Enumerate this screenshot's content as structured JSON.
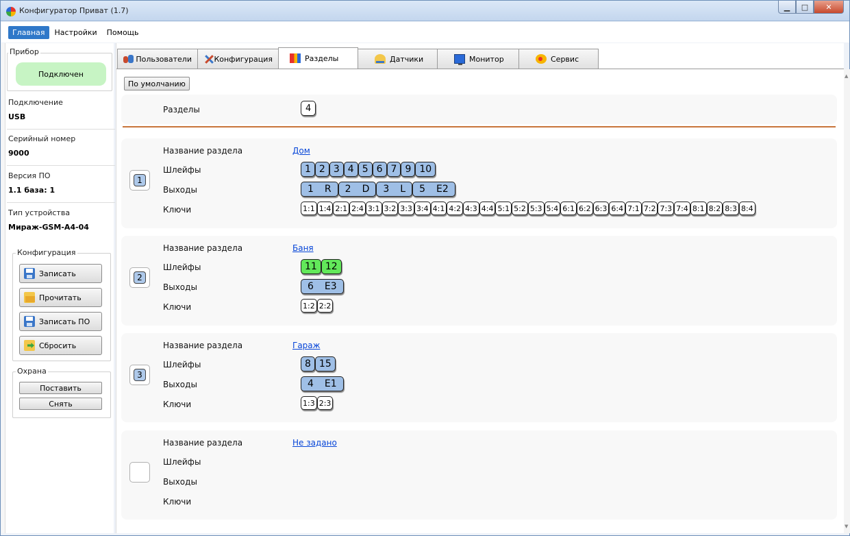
{
  "window": {
    "title": "Конфигуратор Приват (1.7)"
  },
  "menu": [
    "Главная",
    "Настройки",
    "Помощь"
  ],
  "left": {
    "device_group": "Прибор",
    "status": "Подключен",
    "info": [
      {
        "label": "Подключение",
        "value": "USB"
      },
      {
        "label": "Серийный номер",
        "value": "9000"
      },
      {
        "label": "Версия ПО",
        "value": "1.1 база: 1"
      },
      {
        "label": "Тип устройства",
        "value": "Мираж-GSM-A4-04"
      }
    ],
    "config_group": "Конфигурация",
    "config_buttons": [
      "Записать",
      "Прочитать",
      "Записать ПО",
      "Сбросить"
    ],
    "guard_group": "Охрана",
    "guard_buttons": [
      "Поставить",
      "Снять"
    ]
  },
  "tabs": [
    "Пользователи",
    "Конфигурация",
    "Разделы",
    "Датчики",
    "Монитор",
    "Сервис"
  ],
  "selected_tab": "Разделы",
  "default_button": "По умолчанию",
  "partitions_label": "Разделы",
  "partitions_count": "4",
  "field_labels": {
    "name": "Название раздела",
    "loops": "Шлейфы",
    "outputs": "Выходы",
    "keys": "Ключи"
  },
  "partitions": [
    {
      "num": "1",
      "name": "Дом",
      "loops": [
        "1",
        "2",
        "3",
        "4",
        "5",
        "6",
        "7",
        "9",
        "10"
      ],
      "outputs": [
        [
          "1",
          "R"
        ],
        [
          "2",
          "D"
        ],
        [
          "3",
          "L"
        ],
        [
          "5",
          "E2"
        ]
      ],
      "keys": [
        "1:1",
        "1:4",
        "2:1",
        "2:4",
        "3:1",
        "3:2",
        "3:3",
        "3:4",
        "4:1",
        "4:2",
        "4:3",
        "4:4",
        "5:1",
        "5:2",
        "5:3",
        "5:4",
        "6:1",
        "6:2",
        "6:3",
        "6:4",
        "7:1",
        "7:2",
        "7:3",
        "7:4",
        "8:1",
        "8:2",
        "8:3",
        "8:4"
      ]
    },
    {
      "num": "2",
      "name": "Баня",
      "loops": [
        "11",
        "12"
      ],
      "loops_color": "#62e85a",
      "outputs": [
        [
          "6",
          "E3"
        ]
      ],
      "keys": [
        "1:2",
        "2:2"
      ]
    },
    {
      "num": "3",
      "name": "Гараж",
      "loops": [
        "8",
        "15"
      ],
      "outputs": [
        [
          "4",
          "E1"
        ]
      ],
      "keys": [
        "1:3",
        "2:3"
      ]
    },
    {
      "num": "",
      "name": "Не задано",
      "loops": [],
      "outputs": [],
      "keys": []
    }
  ],
  "colors": {
    "chip": "#9fbfe6",
    "chip_green": "#62e85a",
    "accent": "#2f78c9",
    "connected": "#c7f4c4"
  }
}
